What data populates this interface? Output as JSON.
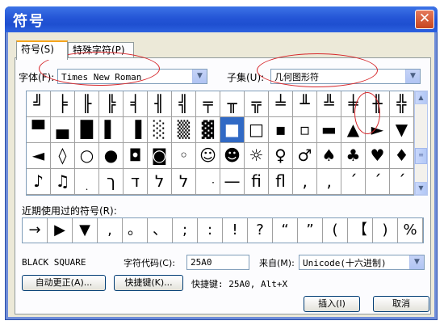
{
  "window": {
    "title": "符号",
    "close": "✕"
  },
  "tabs": [
    {
      "label": "符号(S)"
    },
    {
      "label": "特殊字符(P)"
    }
  ],
  "font": {
    "label": "字体(F):",
    "value": "Times New Roman"
  },
  "subset": {
    "label": "子集(U):",
    "value": "几何图形符"
  },
  "grid": [
    [
      "╝",
      "╞",
      "╟",
      "╠",
      "╡",
      "╢",
      "╣",
      "╤",
      "╥",
      "╦",
      "╧",
      "╨",
      "╩",
      "╪",
      "╫",
      "╬"
    ],
    [
      "▀",
      "▄",
      "█",
      "▌",
      "▐",
      "░",
      "▒",
      "▓",
      "■",
      "□",
      "▪",
      "▫",
      "▬",
      "▲",
      "►",
      "▼"
    ],
    [
      "◄",
      "◊",
      "○",
      "●",
      "◘",
      "◙",
      "◦",
      "☺",
      "☻",
      "☼",
      "♀",
      "♂",
      "♠",
      "♣",
      "♥",
      "♦"
    ],
    [
      "♪",
      "♫",
      "ׅ",
      "ך",
      "ד",
      "ל",
      "ל",
      "ּ",
      "—",
      "ﬁ",
      "ﬂ",
      "‚",
      "‚",
      "ˊ",
      "ˊ",
      "ˊ"
    ]
  ],
  "selected_symbol": "■",
  "recent": {
    "label": "近期使用过的符号(R):",
    "symbols": [
      "→",
      "▶",
      "▼",
      ",",
      "。",
      "、",
      ";",
      ":",
      "!",
      "?",
      "“",
      "”",
      "(",
      "【",
      ")",
      "%"
    ]
  },
  "char_name": "BLACK SQUARE",
  "char_code": {
    "label": "字符代码(C):",
    "value": "25A0"
  },
  "from": {
    "label": "来自(M):",
    "value": "Unicode(十六进制)"
  },
  "buttons": {
    "autocorrect": "自动更正(A)...",
    "shortcut_key": "快捷键(K)...",
    "insert": "插入(I)",
    "cancel": "取消"
  },
  "shortcut_hint": "快捷键: 25A0, Alt+X",
  "icons": {
    "dropdown": "chevron-down-icon",
    "scroll_up": "arrow-up-icon",
    "scroll_down": "arrow-down-icon"
  }
}
